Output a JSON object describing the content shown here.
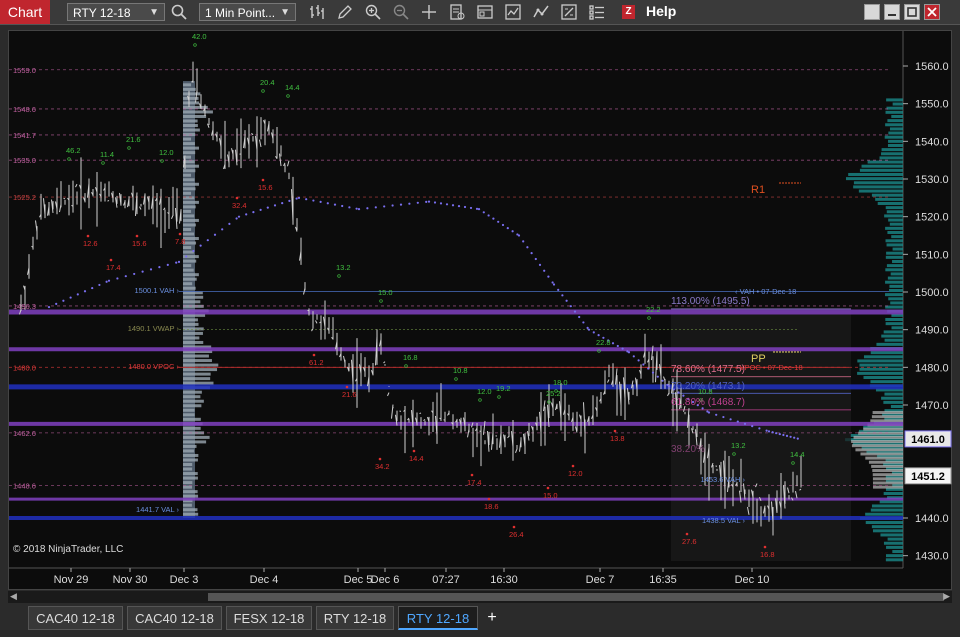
{
  "toolbar": {
    "chart_tab": "Chart",
    "instrument": "RTY 12-18",
    "interval": "1 Min Point...",
    "help": "Help",
    "z_logo": "Z"
  },
  "price_axis": {
    "ticks": [
      "1560.0",
      "1550.0",
      "1540.0",
      "1530.0",
      "1520.0",
      "1510.0",
      "1500.0",
      "1490.0",
      "1480.0",
      "1470.0",
      "1461.0",
      "1451.2",
      "1440.0",
      "1430.0"
    ],
    "current_price": "1461.0",
    "last_price": "1451.2"
  },
  "time_axis": {
    "ticks": [
      "Nov 29",
      "Nov 30",
      "Dec 3",
      "Dec 4",
      "Dec 5",
      "Dec 6",
      "07:27",
      "16:30",
      "Dec 7",
      "16:35",
      "Dec 10"
    ]
  },
  "left_levels": [
    "1559.0",
    "1548.6",
    "1541.7",
    "1535.0",
    "1525.2",
    "1496.3",
    "1480.0",
    "1462.6",
    "1448.6"
  ],
  "profile_labels": {
    "vah": "1500.1 VAH ›",
    "vwap": "1490.1 VWAP ›",
    "vpoc": "1480.0 VPOC ›",
    "val": "1441.7 VAL ›",
    "vah_dec7": "‹ VAH • 07-Dec-18",
    "vpoc_dec7": "‹ VPOC • 07-Dec-18",
    "vah2": "1453.6 VAH ›",
    "val2": "1438.5 VAL ›"
  },
  "pivots": {
    "r1": "R1",
    "pp": "PP"
  },
  "fib": {
    "f1": "113.00% (1495.5)",
    "f2": "78.60% (1477.5)",
    "f3": "70.20% (1473.1)",
    "f4": "61.80% (1468.7)",
    "f5": "38.20%"
  },
  "bar_labels_green": [
    "42.0",
    "20.4",
    "14.4",
    "46.2",
    "11.4",
    "21.6",
    "12.0",
    "13.2",
    "15.0",
    "16.8",
    "10.8",
    "12.0",
    "19.2",
    "18.0",
    "25.2",
    "22.8",
    "22.2",
    "10.8",
    "13.2",
    "14.4"
  ],
  "bar_labels_red": [
    "32.4",
    "15.6",
    "12.6",
    "17.4",
    "15.6",
    "7.8",
    "61.2",
    "21.6",
    "34.2",
    "14.4",
    "17.4",
    "18.6",
    "26.4",
    "15.0",
    "12.0",
    "13.8",
    "27.6",
    "16.8"
  ],
  "copyright": "© 2018 NinjaTrader, LLC",
  "tabs": [
    {
      "label": "CAC40 12-18"
    },
    {
      "label": "CAC40 12-18"
    },
    {
      "label": "FESX 12-18"
    },
    {
      "label": "RTY 12-18"
    },
    {
      "label": "RTY 12-18"
    }
  ],
  "add_tab": "+",
  "colors": {
    "red": "#c0262e",
    "blue_accent": "#4fa7ff",
    "bars": "#cfcfcf",
    "vwap": "#7a6ff0",
    "profile": "#1a8a8a"
  }
}
